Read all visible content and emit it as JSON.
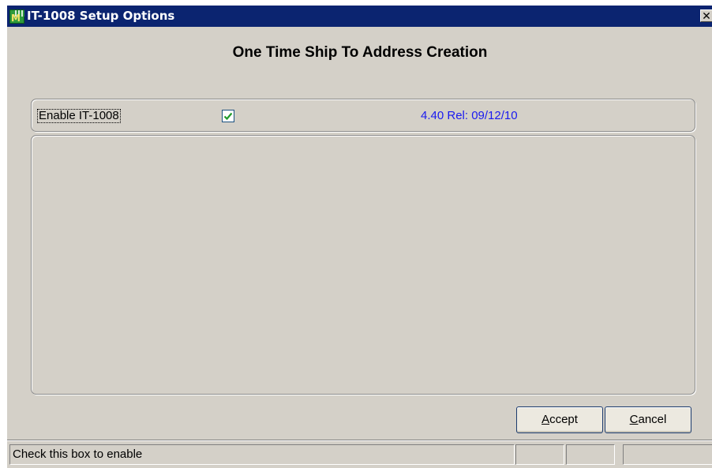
{
  "window": {
    "title": "IT-1008 Setup Options",
    "app_icon": "sage-mas-app-icon",
    "close_icon": "close-icon"
  },
  "heading": "One Time Ship To Address Creation",
  "options": {
    "enable_label": "Enable IT-1008",
    "enable_checked": true,
    "version": "4.40  Rel: 09/12/10"
  },
  "buttons": {
    "accept_prefix": "A",
    "accept_rest": "ccept",
    "cancel_prefix": "C",
    "cancel_rest": "ancel"
  },
  "statusbar": {
    "message": "Check this box to enable",
    "panel2": "",
    "panel3": "",
    "panel4": ""
  },
  "colors": {
    "titlebar": "#0b2470",
    "dialog_bg": "#d4d0c8",
    "version_text": "#1a1af0",
    "checkmark": "#1f9a2a"
  }
}
